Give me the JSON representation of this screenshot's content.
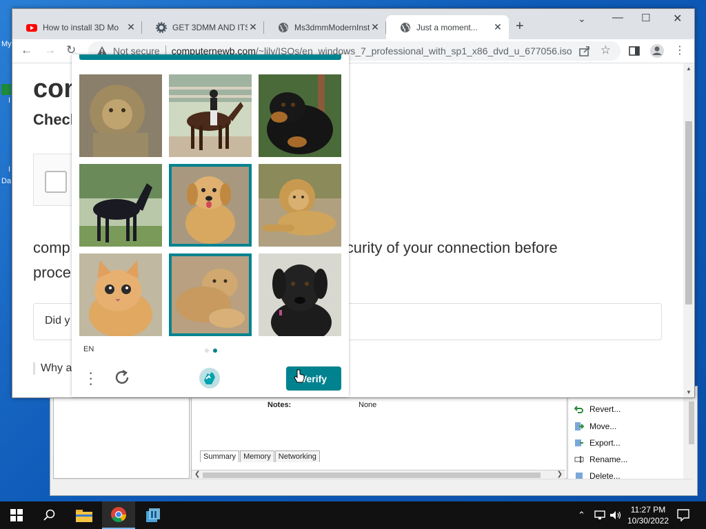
{
  "desktop": {
    "labels": [
      "My",
      "I",
      "I",
      "Da"
    ]
  },
  "hyperv": {
    "notes_label": "Notes:",
    "notes_value": "None",
    "tabs": [
      "Summary",
      "Memory",
      "Networking"
    ],
    "actions": [
      "Revert...",
      "Move...",
      "Export...",
      "Rename...",
      "Delete..."
    ]
  },
  "browser": {
    "tabs": [
      {
        "title": "How to install 3D Mo",
        "favicon": "youtube-icon"
      },
      {
        "title": "GET 3DMM AND ITS",
        "favicon": "gear-favicon-icon"
      },
      {
        "title": "Ms3dmmModernInst",
        "favicon": "globe-icon"
      },
      {
        "title": "Just a moment...",
        "favicon": "globe-icon"
      }
    ],
    "security_label": "Not secure",
    "url_host": "computernewb.com",
    "url_path": "/~lily/ISOs/en_windows_7_professional_with_sp1_x86_dvd_u_677056.iso"
  },
  "page": {
    "heading": "con",
    "subheading": "Check",
    "paragraph_start": "comp",
    "paragraph_end": "curity of your connection before",
    "paragraph_line2": "proce",
    "details_label": "Did y",
    "why_label": "Why a"
  },
  "captcha": {
    "language": "EN",
    "verify_label": "Verify",
    "accent_color": "#00838f",
    "images": [
      {
        "subject": "lion",
        "selected": false
      },
      {
        "subject": "horse-with-rider",
        "selected": false
      },
      {
        "subject": "black-dog",
        "selected": false
      },
      {
        "subject": "black-horse",
        "selected": false
      },
      {
        "subject": "golden-puppy",
        "selected": true
      },
      {
        "subject": "lion-lying",
        "selected": false
      },
      {
        "subject": "kitten",
        "selected": false
      },
      {
        "subject": "lion-cub",
        "selected": true
      },
      {
        "subject": "black-dog-portrait",
        "selected": false
      }
    ],
    "page_indicator": {
      "count": 2,
      "current": 2
    }
  },
  "taskbar": {
    "apps": [
      "file-explorer",
      "chrome",
      "hyper-v-manager"
    ],
    "time": "11:27 PM",
    "date": "10/30/2022"
  }
}
